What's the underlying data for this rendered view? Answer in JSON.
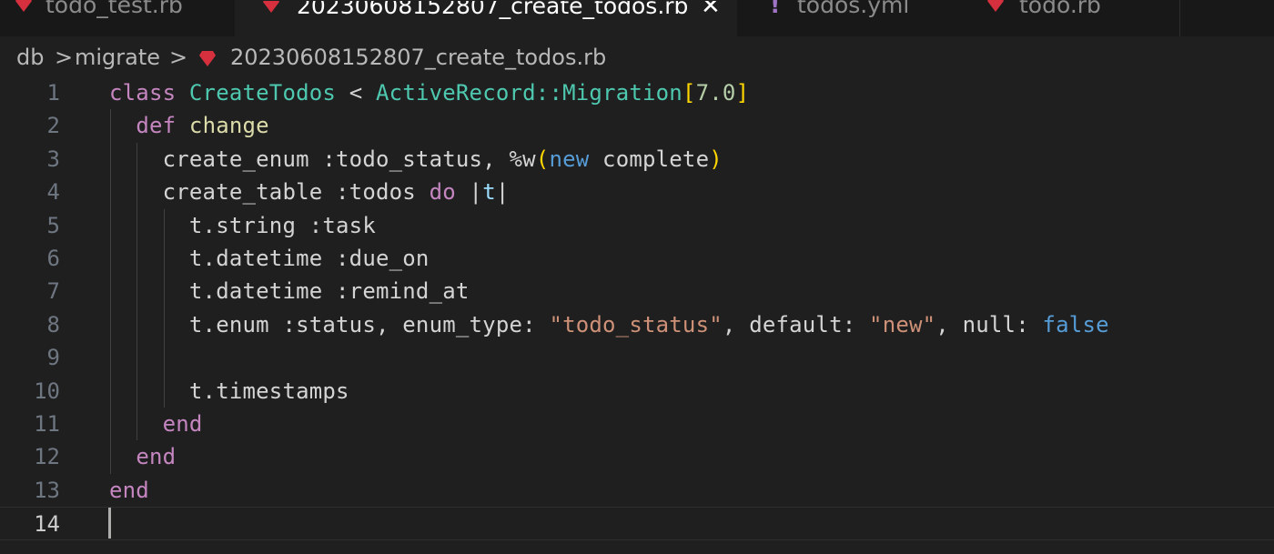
{
  "tabs": [
    {
      "label": "todo_test.rb",
      "icon": "ruby-icon",
      "active": false
    },
    {
      "label": "20230608152807_create_todos.rb",
      "icon": "ruby-icon",
      "active": true
    },
    {
      "label": "todos.yml",
      "icon": "warning-icon",
      "active": false
    },
    {
      "label": "todo.rb",
      "icon": "ruby-icon",
      "active": false
    }
  ],
  "tab_close_glyph": "✕",
  "warning_glyph": "!",
  "breadcrumb": {
    "items": [
      "db",
      "migrate",
      "20230608152807_create_todos.rb"
    ],
    "separator": ">"
  },
  "code": {
    "current_line": 14,
    "lines": [
      {
        "number": "1",
        "tokens": [
          {
            "t": "class",
            "k": "kw"
          },
          {
            "t": " ",
            "k": "txt"
          },
          {
            "t": "CreateTodos",
            "k": "cls"
          },
          {
            "t": " < ",
            "k": "txt"
          },
          {
            "t": "ActiveRecord::Migration",
            "k": "cls"
          },
          {
            "t": "[",
            "k": "br"
          },
          {
            "t": "7.0",
            "k": "num"
          },
          {
            "t": "]",
            "k": "br"
          }
        ]
      },
      {
        "number": "2",
        "tokens": [
          {
            "t": "  ",
            "k": "txt"
          },
          {
            "t": "def",
            "k": "kw"
          },
          {
            "t": " ",
            "k": "txt"
          },
          {
            "t": "change",
            "k": "fn"
          }
        ]
      },
      {
        "number": "3",
        "tokens": [
          {
            "t": "    create_enum :todo_status, %w",
            "k": "txt"
          },
          {
            "t": "(",
            "k": "br"
          },
          {
            "t": "new",
            "k": "const"
          },
          {
            "t": " complete",
            "k": "txt"
          },
          {
            "t": ")",
            "k": "br"
          }
        ]
      },
      {
        "number": "4",
        "tokens": [
          {
            "t": "    create_table :todos ",
            "k": "txt"
          },
          {
            "t": "do",
            "k": "kw"
          },
          {
            "t": " |",
            "k": "txt"
          },
          {
            "t": "t",
            "k": "var"
          },
          {
            "t": "|",
            "k": "txt"
          }
        ]
      },
      {
        "number": "5",
        "tokens": [
          {
            "t": "      t.string :task",
            "k": "txt"
          }
        ]
      },
      {
        "number": "6",
        "tokens": [
          {
            "t": "      t.datetime :due_on",
            "k": "txt"
          }
        ]
      },
      {
        "number": "7",
        "tokens": [
          {
            "t": "      t.datetime :remind_at",
            "k": "txt"
          }
        ]
      },
      {
        "number": "8",
        "tokens": [
          {
            "t": "      t.enum :status, enum_type: ",
            "k": "txt"
          },
          {
            "t": "\"todo_status\"",
            "k": "str"
          },
          {
            "t": ", default: ",
            "k": "txt"
          },
          {
            "t": "\"new\"",
            "k": "str"
          },
          {
            "t": ", null: ",
            "k": "txt"
          },
          {
            "t": "false",
            "k": "const"
          }
        ]
      },
      {
        "number": "9",
        "tokens": []
      },
      {
        "number": "10",
        "tokens": [
          {
            "t": "      t.timestamps",
            "k": "txt"
          }
        ]
      },
      {
        "number": "11",
        "tokens": [
          {
            "t": "    ",
            "k": "txt"
          },
          {
            "t": "end",
            "k": "kw"
          }
        ]
      },
      {
        "number": "12",
        "tokens": [
          {
            "t": "  ",
            "k": "txt"
          },
          {
            "t": "end",
            "k": "kw"
          }
        ]
      },
      {
        "number": "13",
        "tokens": [
          {
            "t": "end",
            "k": "kw"
          }
        ]
      },
      {
        "number": "14",
        "tokens": []
      }
    ]
  },
  "colors": {
    "background": "#1f1f1f",
    "tabbar": "#181818",
    "keyword": "#c586c0",
    "class": "#4ec9b0",
    "function": "#dcdcaa",
    "number": "#b5cea8",
    "bracket": "#ffd700",
    "string": "#ce9178",
    "constant": "#569cd6",
    "ruby_icon": "#d6303f",
    "warning_icon": "#a074c4"
  }
}
